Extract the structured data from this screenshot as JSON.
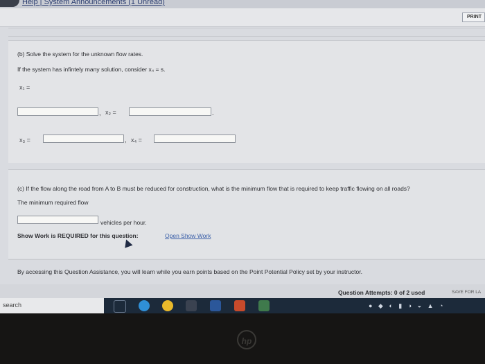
{
  "header": {
    "links_text": "Help | System Announcements (1 Unread)",
    "print_label": "PRINT"
  },
  "part_b": {
    "heading": "(b) Solve the system for the unknown flow rates.",
    "instruction": "If the system has infintely many solution, consider x₄ = s.",
    "x1_label": "x₁ =",
    "x2_label": "x₂ =",
    "x3_label": "x₃ =",
    "x4_label": "x₄ ="
  },
  "part_c": {
    "question": "(c) If the flow along the road from A to B must be reduced for construction, what is the minimum flow that is required to keep traffic flowing on all roads?",
    "prompt": "The minimum required flow",
    "unit_label": "vehicles per hour.",
    "show_work_text": "Show Work is REQUIRED for this question:",
    "show_work_link": "Open Show Work"
  },
  "assistance_note": "By accessing this Question Assistance, you will learn while you earn points based on the Point Potential Policy set by your instructor.",
  "footer": {
    "attempts": "Question Attempts: 0 of 2 used",
    "save_label": "SAVE FOR LA"
  },
  "taskbar": {
    "search_label": "search",
    "icons": [
      "task-view-icon",
      "edge-icon",
      "chrome-icon",
      "camera-icon",
      "word-icon",
      "powerpoint-icon",
      "photos-icon"
    ]
  },
  "colors": {
    "accent": "#3a5fa8",
    "taskbar": "#1c2a3a",
    "page": "#e3e4e7"
  }
}
